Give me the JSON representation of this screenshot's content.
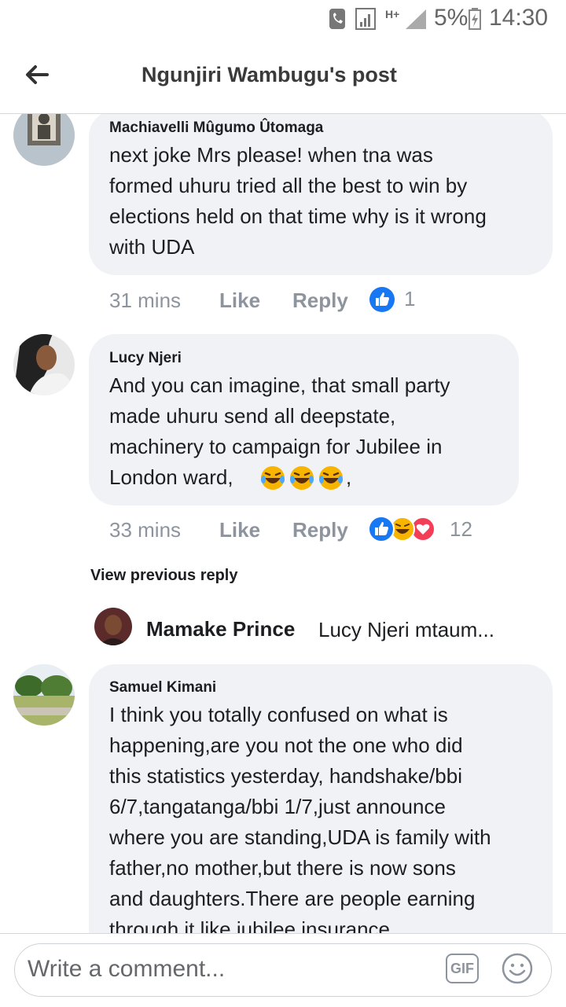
{
  "status_bar": {
    "battery": "5%",
    "time": "14:30",
    "network": "H+"
  },
  "header": {
    "title": "Ngunjiri Wambugu's post"
  },
  "comments": [
    {
      "author": "Machiavelli Mûgumo Ûtomaga",
      "lines": [
        "next joke  Mrs please! when tna was",
        "formed uhuru tried all the best to win by",
        "elections held on that time why is it wrong",
        "with UDA"
      ],
      "time": "31 mins",
      "like": "Like",
      "reply": "Reply",
      "reaction_count": "1"
    },
    {
      "author": "Lucy Njeri",
      "lines": [
        "And you  can imagine,  that small party",
        "made uhuru send all deepstate,",
        "machinery to campaign for Jubilee in",
        "London ward,"
      ],
      "trailing": ",",
      "time": "33 mins",
      "like": "Like",
      "reply": "Reply",
      "reaction_count": "12"
    },
    {
      "author": "Samuel Kimani",
      "lines": [
        "I think you totally confused on what is",
        "happening,are you not the one who did",
        "this statistics yesterday, handshake/bbi",
        "6/7,tangatanga/bbi 1/7,just announce",
        "where you are standing,UDA is family with",
        "father,no mother,but there is now sons",
        "and daughters.There are people earning",
        "through it like jubilee insurance"
      ]
    }
  ],
  "view_previous": "View previous reply",
  "reply_preview": {
    "name": "Mamake Prince",
    "snippet": "Lucy Njeri mtaum..."
  },
  "composer": {
    "placeholder": "Write a comment...",
    "gif": "GIF"
  }
}
